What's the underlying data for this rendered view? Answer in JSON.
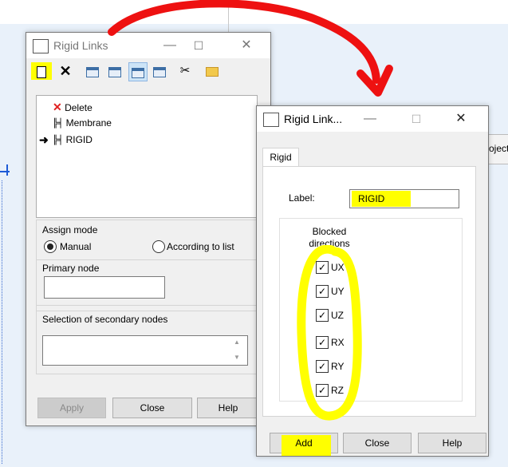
{
  "colors": {
    "highlight": "#ffff00",
    "annotation_arrow": "#ee1111",
    "selection": "#cce4f7"
  },
  "left_window": {
    "title": "Rigid Links",
    "toolbar_icons": [
      "new-icon",
      "delete-x-icon",
      "view1-icon",
      "view2-icon",
      "view3-icon",
      "table-icon",
      "scissors-icon",
      "folder-icon"
    ],
    "tree": {
      "items": [
        {
          "label": "Delete",
          "icon": "red-x-icon"
        },
        {
          "label": "Membrane",
          "icon": "rigid-link-icon"
        },
        {
          "label": "RIGID",
          "icon": "rigid-link-icon",
          "current": true
        }
      ],
      "current_marker": "➜"
    },
    "assign_mode": {
      "title": "Assign mode",
      "manual": "Manual",
      "according": "According to list",
      "selected": "Manual"
    },
    "primary_node": {
      "title": "Primary node",
      "value": ""
    },
    "secondary": {
      "title": "Selection of secondary nodes",
      "value": ""
    },
    "buttons": {
      "apply": "Apply",
      "close": "Close",
      "help": "Help"
    }
  },
  "right_window": {
    "title": "Rigid Link...",
    "tab": "Rigid",
    "label_caption": "Label:",
    "label_value": "RIGID",
    "blocked_title": "Blocked directions",
    "directions": [
      {
        "label": "UX",
        "checked": true
      },
      {
        "label": "UY",
        "checked": true
      },
      {
        "label": "UZ",
        "checked": true
      },
      {
        "label": "RX",
        "checked": true
      },
      {
        "label": "RY",
        "checked": true
      },
      {
        "label": "RZ",
        "checked": true
      }
    ],
    "buttons": {
      "add": "Add",
      "close": "Close",
      "help": "Help"
    }
  },
  "background": {
    "right_partial_text": "ojects"
  }
}
